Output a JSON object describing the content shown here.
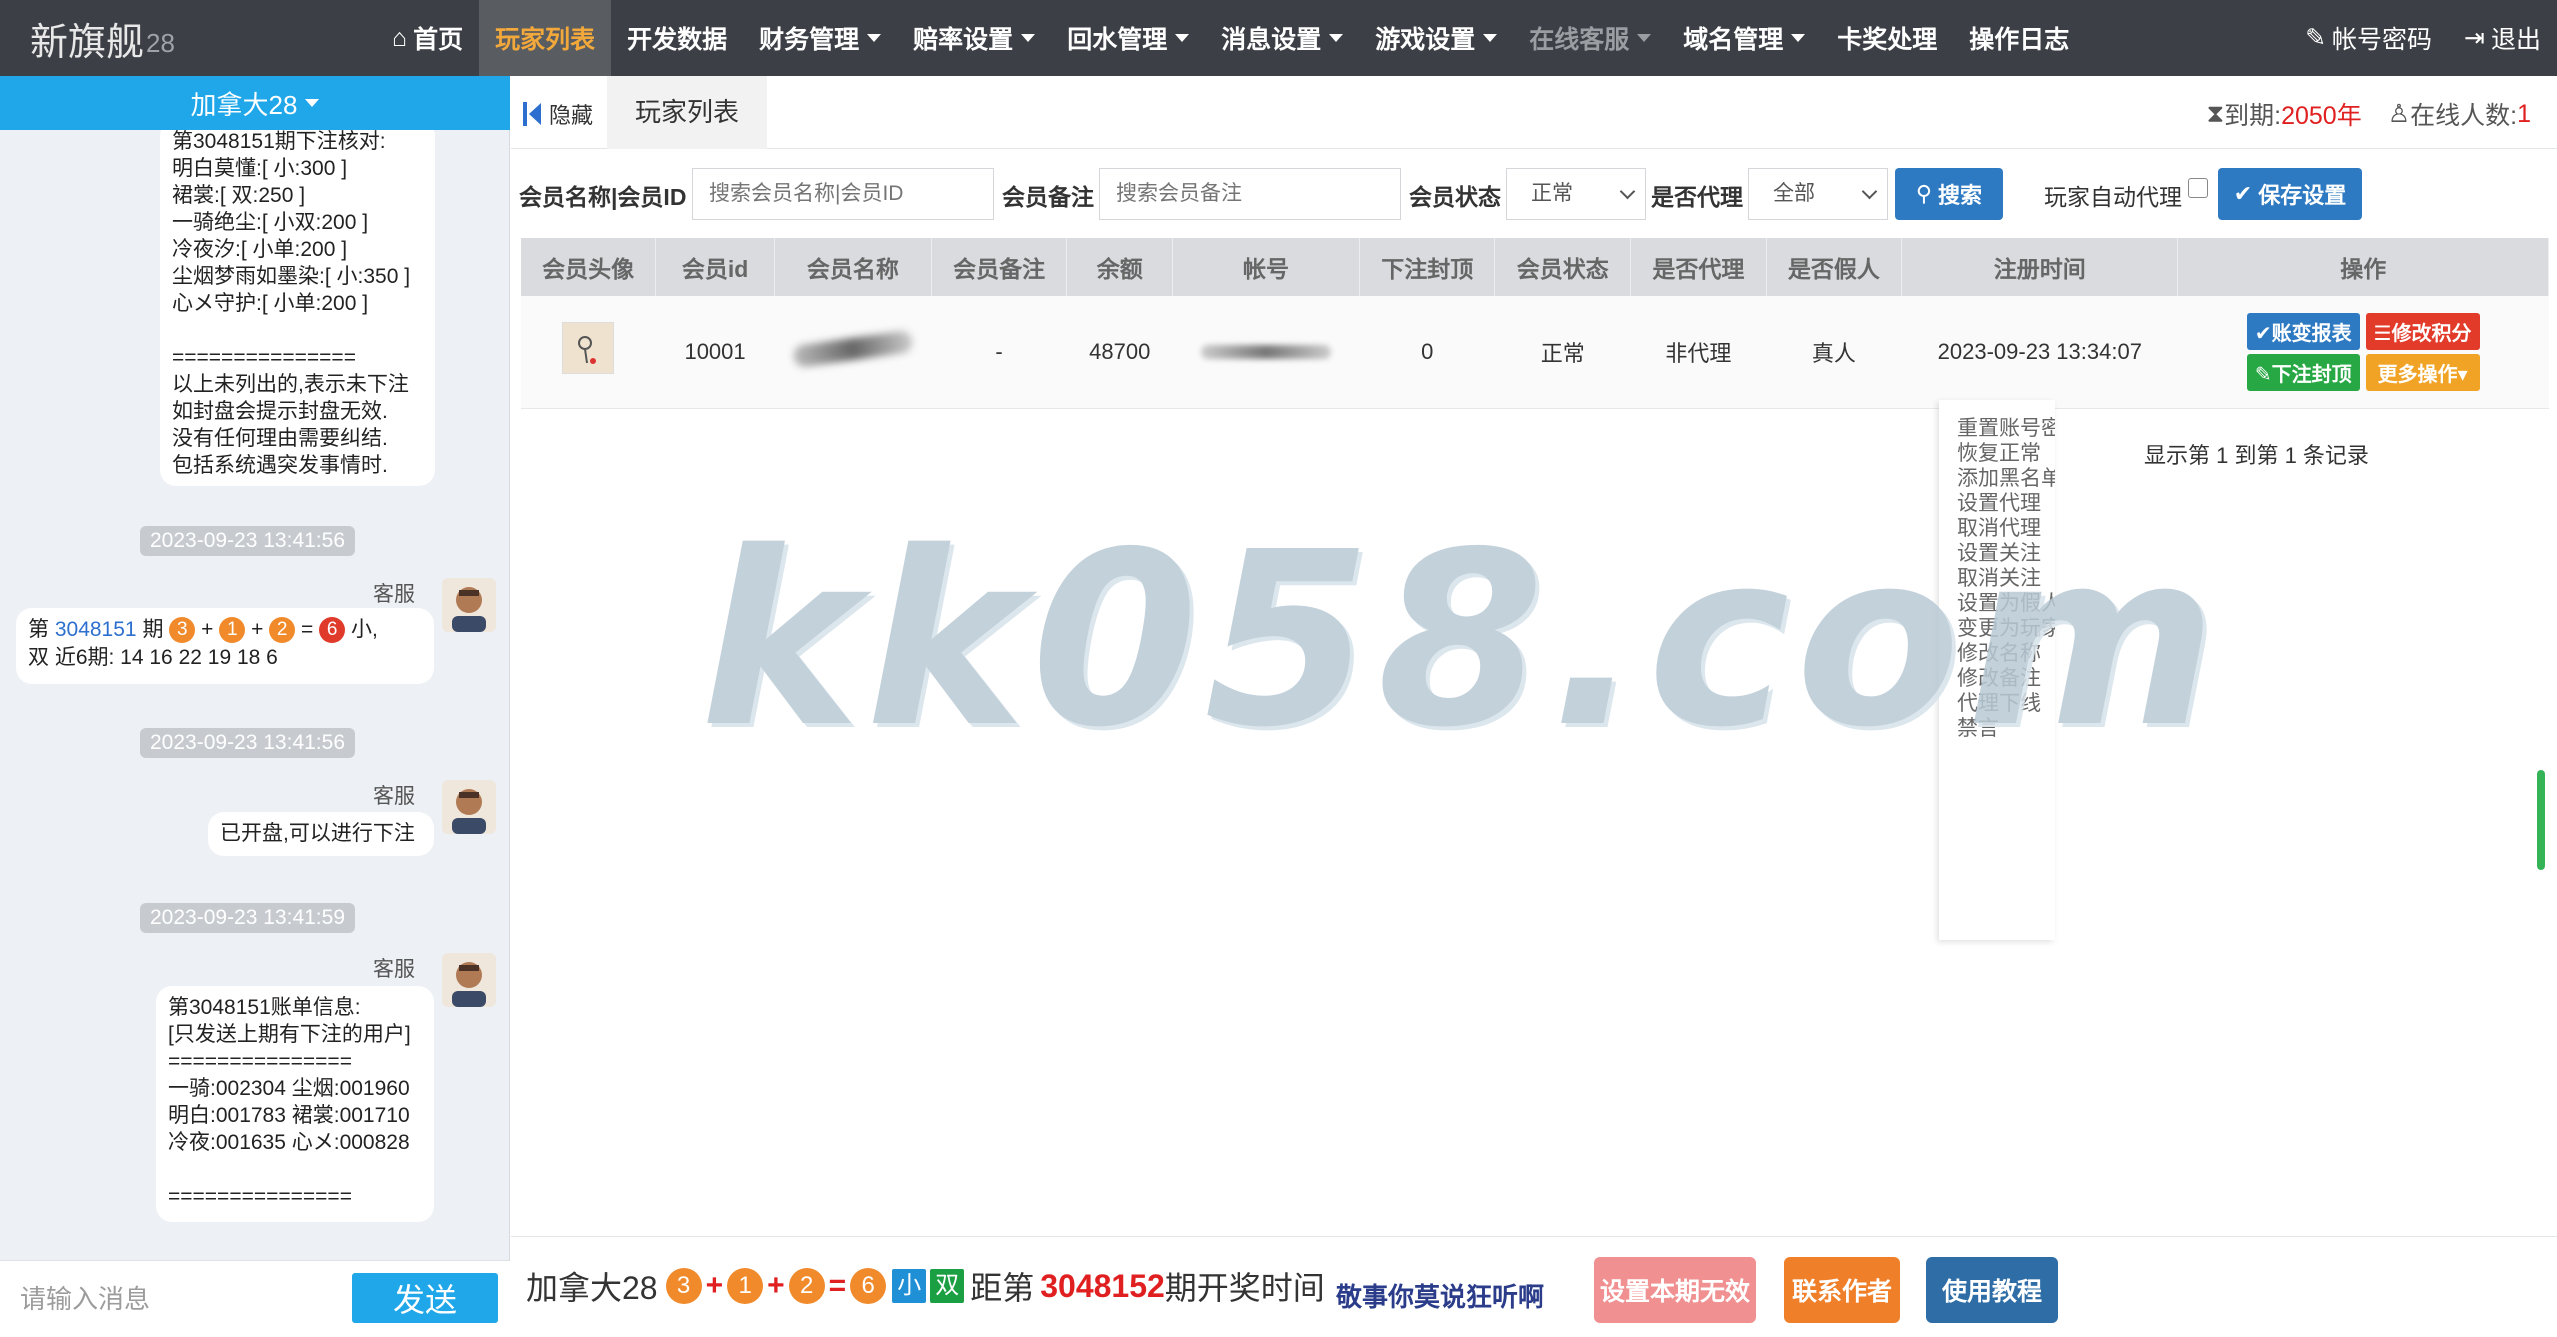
{
  "brand": {
    "name": "新旗舰",
    "sub": "28"
  },
  "nav": {
    "home": "首页",
    "items": [
      "玩家列表",
      "开发数据",
      "财务管理",
      "赔率设置",
      "回水管理",
      "消息设置",
      "游戏设置",
      "在线客服",
      "域名管理",
      "卡奖处理",
      "操作日志"
    ],
    "account": "帐号密码",
    "logout": "退出"
  },
  "chat": {
    "region": "加拿大28",
    "msg1_lines": "第3048151期下注核对:\n明白莫懂:[ 小:300 ]\n裙裳:[ 双:250 ]\n一骑绝尘:[ 小双:200 ]\n冷夜汐:[ 小单:200 ]\n尘烟梦雨如墨染:[ 小:350 ]\n心メ守护:[ 小单:200 ]\n\n===============\n以上未列出的,表示未下注\n如封盘会提示封盘无效.\n没有任何理由需要纠结.\n包括系统遇突发事情时.",
    "time1": "2023-09-23 13:41:56",
    "sender": "客服",
    "msg2_pre": "第",
    "msg2_period": "3048151",
    "msg2_mid": "期",
    "msg2_balls": [
      "3",
      "1",
      "2",
      "6"
    ],
    "msg2_tail": "小,",
    "msg2_line2": "双 近6期: 14 16 22 19 18 6",
    "time2": "2023-09-23 13:41:56",
    "msg3": "已开盘,可以进行下注",
    "time3": "2023-09-23 13:41:59",
    "msg4_lines": "第3048151账单信息:\n[只发送上期有下注的用户]\n===============\n一骑:002304 尘烟:001960\n明白:001783 裙裳:001710\n冷夜:001635 心メ:000828\n\n===============",
    "input_placeholder": "请输入消息",
    "send": "发送"
  },
  "tabs": {
    "hide": "隐藏",
    "current": "玩家列表"
  },
  "status": {
    "expire_label": "到期:",
    "expire_value": "2050年",
    "online_label": "在线人数:",
    "online_value": "1"
  },
  "filters": {
    "name_label": "会员名称|会员ID",
    "name_placeholder": "搜索会员名称|会员ID",
    "remark_label": "会员备注",
    "remark_placeholder": "搜索会员备注",
    "status_label": "会员状态",
    "status_value": "正常",
    "agent_label": "是否代理",
    "agent_value": "全部",
    "search": "搜索",
    "auto_agent": "玩家自动代理",
    "save": "保存设置"
  },
  "table": {
    "headers": [
      "会员头像",
      "会员id",
      "会员名称",
      "会员备注",
      "余额",
      "帐号",
      "下注封顶",
      "会员状态",
      "是否代理",
      "是否假人",
      "注册时间",
      "操作"
    ],
    "row": {
      "id": "10001",
      "remark": "-",
      "balance": "48700",
      "bet_cap": "0",
      "status": "正常",
      "agent": "非代理",
      "fake": "真人",
      "reg_time": "2023-09-23 13:34:07"
    },
    "ops": [
      "账变报表",
      "修改积分",
      "下注封顶",
      "更多操作"
    ]
  },
  "pager": "显示第 1 到第 1 条记录",
  "more_menu": [
    "重置账号密码",
    "恢复正常",
    "添加黑名单",
    "设置代理",
    "取消代理",
    "设置关注",
    "取消关注",
    "设置为假人",
    "变更为玩家",
    "修改名称",
    "修改备注",
    "代理下线",
    "禁言"
  ],
  "watermark": "kk058.com",
  "bottom": {
    "game": "加拿大28",
    "balls": [
      "3",
      "1",
      "2",
      "6"
    ],
    "tag_small": "小",
    "tag_even": "双",
    "dist_label": "距第",
    "next_period": "3048152",
    "open_label": "期开奖时间",
    "marquee": "敬事你莫说狂听啊",
    "btn_invalid": "设置本期无效",
    "btn_contact": "联系作者",
    "btn_tutorial": "使用教程"
  },
  "colors": {
    "topbar": "#3c3f45",
    "accent": "#f2a83a",
    "blue": "#1fa7ea",
    "primary": "#2e7ac2",
    "red": "#e02020"
  }
}
